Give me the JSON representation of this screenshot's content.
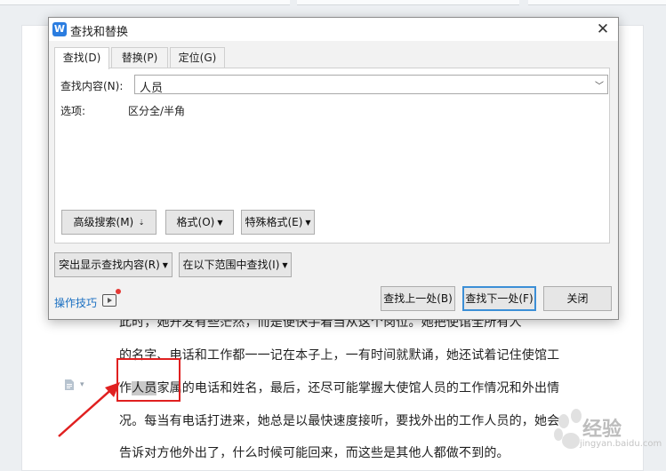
{
  "dialog": {
    "title": "查找和替换",
    "app_icon_glyph": "W",
    "close_glyph": "✕",
    "tabs": [
      {
        "label": "查找(D)"
      },
      {
        "label": "替换(P)"
      },
      {
        "label": "定位(G)"
      }
    ],
    "find": {
      "label": "查找内容(N):",
      "value": "人员"
    },
    "options": {
      "label": "选项:",
      "value": "区分全/半角"
    },
    "buttons": {
      "advanced_search": "高级搜索(M)",
      "format": "格式(O)",
      "special_format": "特殊格式(E)",
      "highlight": "突出显示查找内容(R)",
      "find_in": "在以下范围中查找(I)",
      "find_prev": "查找上一处(B)",
      "find_next": "查找下一处(F)",
      "close": "关闭"
    },
    "tips": "操作技巧"
  },
  "document": {
    "lines": [
      "此时，她开发有些茫然，而是便快手着当从这个岗位。她把使馆全所有人",
      "的名字、电话和工作都一一记在本子上，一有时间就默诵，她还试着记住使馆工",
      {
        "pre": "作",
        "hit": "人员",
        "post": "家属的电话和姓名，最后，还尽可能掌握大使馆人员的工作情况和外出情"
      },
      "况。每当有电话打进来，她总是以最快速度接听，要找外出的工作人员的，她会",
      "告诉对方他外出了，什么时候可能回来，而这些是其他人都做不到的。"
    ]
  },
  "watermark": {
    "text": "经验",
    "sub": "jingyan.baidu.com"
  },
  "colors": {
    "highlight_box": "#e02020",
    "link": "#1a6fc1",
    "primary_border": "#3c8fd6"
  }
}
